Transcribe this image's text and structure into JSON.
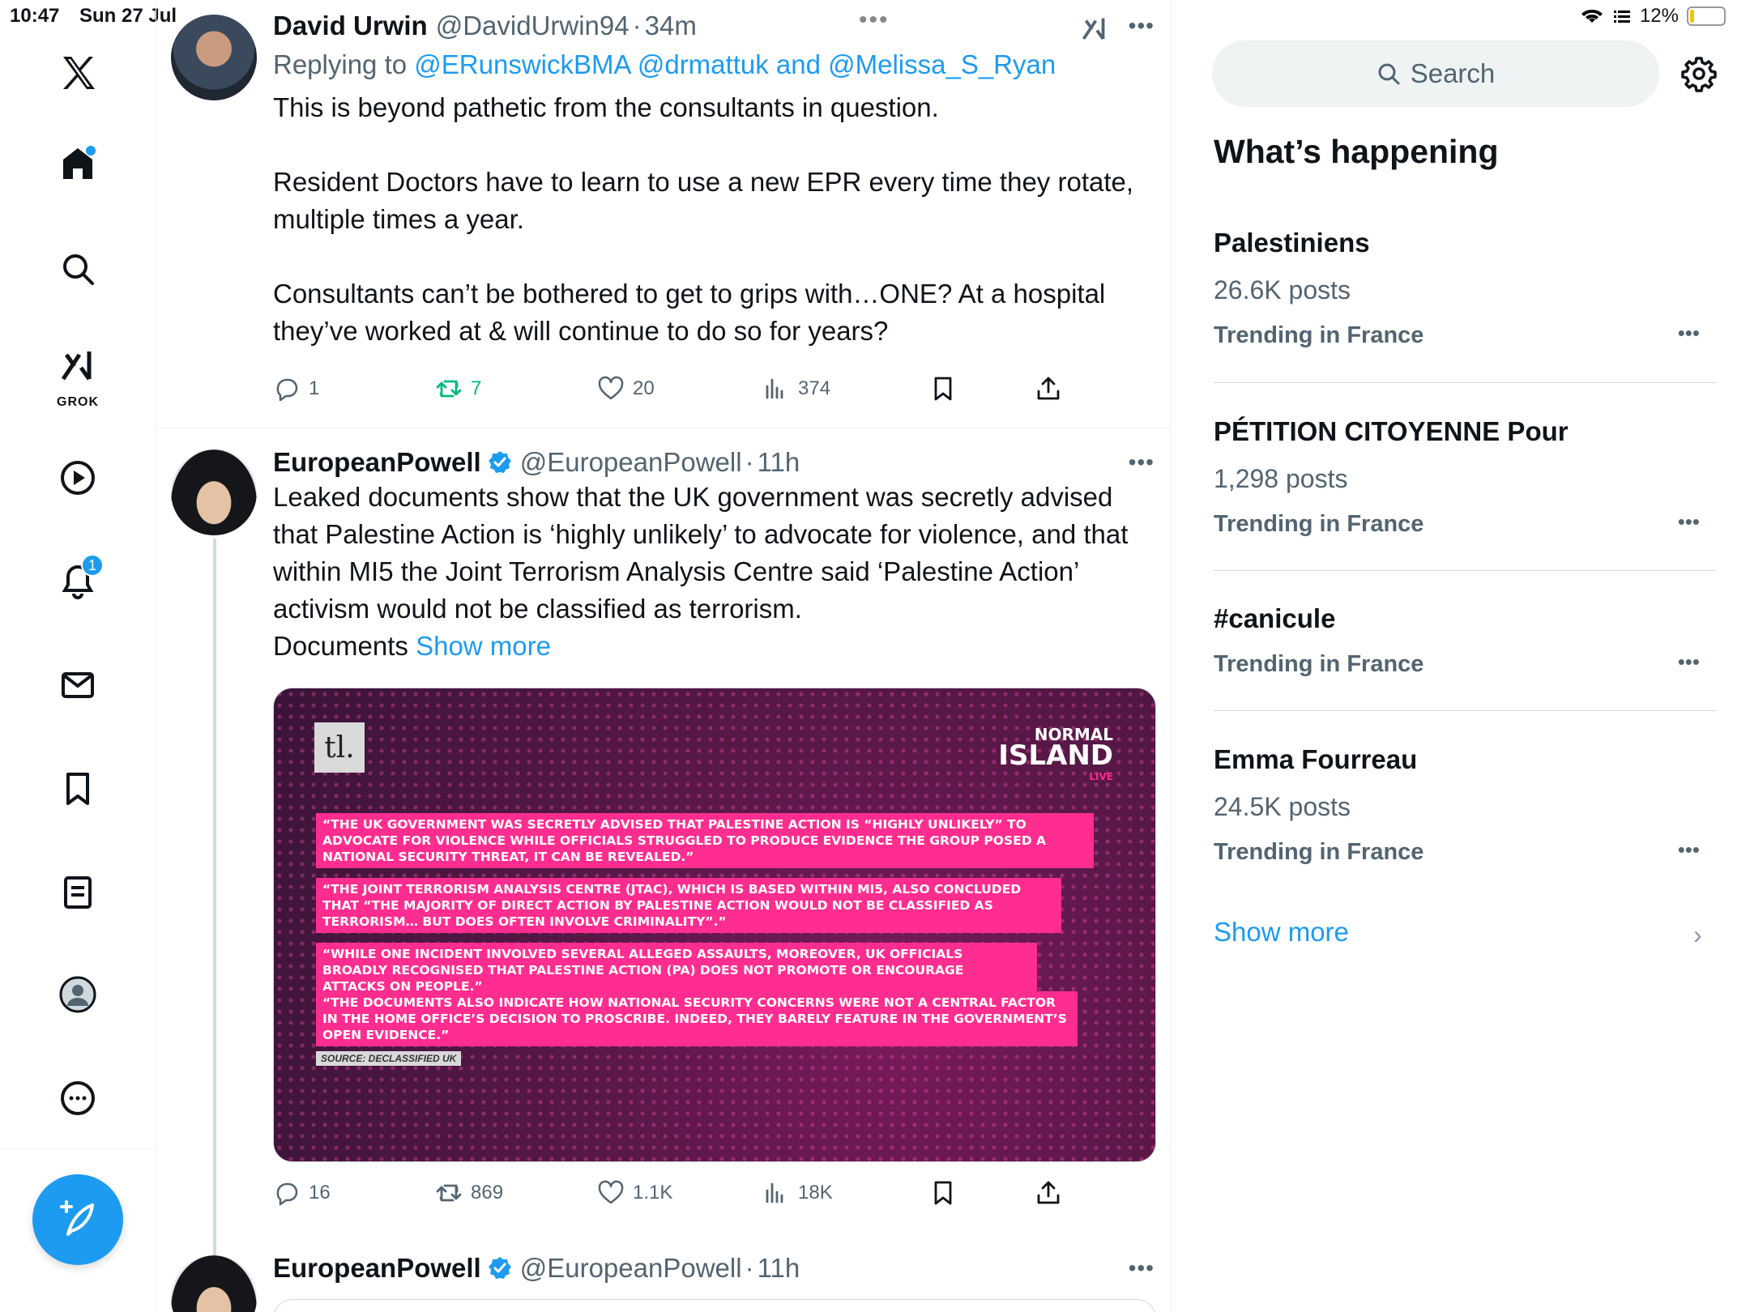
{
  "status_bar": {
    "time": "10:47",
    "date": "Sun 27 Jul",
    "battery": "12%",
    "battery_level": 0.12
  },
  "nav": {
    "logo": "x-logo-icon",
    "items": [
      "home-icon",
      "search-icon",
      "grok-icon",
      "video-icon",
      "notifications-icon",
      "messages-icon",
      "bookmarks-icon",
      "lists-icon",
      "profile-icon",
      "more-icon"
    ],
    "grok_label": "GROK",
    "notifications_badge": "1",
    "compose": "compose-icon"
  },
  "tweets": [
    {
      "name": "David Urwin",
      "handle": "@DavidUrwin94",
      "time": "34m",
      "replying_prefix": "Replying to ",
      "replying_handles": "@ERunswickBMA @drmattuk and @Melissa_S_Ryan",
      "text": "This is beyond pathetic from the consultants in question.\n\nResident Doctors have to learn to use a new EPR every time they rotate, multiple times a year.\n\nConsultants can’t be bothered to get to grips with…ONE? At a hospital they’ve worked at & will continue to do so for years?",
      "replies": "1",
      "retweets": "7",
      "likes": "20",
      "views": "374"
    },
    {
      "name": "EuropeanPowell",
      "handle": "@EuropeanPowell",
      "time": "11h",
      "text": "Leaked documents show that the UK government was secretly advised that Palestine Action is ‘highly unlikely’ to advocate for violence, and that within MI5 the Joint Terrorism Analysis Centre said ‘Palestine Action’ activism would not be classified as terrorism.\nDocuments ",
      "show_more": "Show more",
      "media": {
        "tl_logo": "tl.",
        "brand_line1": "NORMAL",
        "brand_line2": "ISLAND",
        "brand_line3": "LIVE",
        "quotes": [
          "“The UK government was secretly advised that Palestine Action is “highly unlikely” to advocate for violence while officials struggled to produce evidence the group posed a national security threat, it can be revealed.”",
          "“The Joint Terrorism Analysis Centre (JTAC), which is based within MI5, also concluded that “the majority of direct action by Palestine Action would not be classified as terrorism… but does often involve criminality”.”",
          "“While one incident involved several alleged assaults, moreover, UK officials broadly recognised that Palestine Action (PA) does not promote or encourage attacks on people.”",
          "“The documents also indicate how national security concerns were not a central factor in the Home Office’s decision to proscribe. Indeed, they barely feature in the government’s open evidence.”"
        ],
        "source": "SOURCE: DECLASSIFIED UK"
      },
      "replies": "16",
      "retweets": "869",
      "likes": "1.1K",
      "views": "18K"
    },
    {
      "name": "EuropeanPowell",
      "handle": "@EuropeanPowell",
      "time": "11h"
    }
  ],
  "sidebar": {
    "search_placeholder": "Search",
    "section_title": "What’s happening",
    "trends": [
      {
        "title": "Palestiniens",
        "count": "26.6K posts",
        "location": "Trending in France"
      },
      {
        "title": "PÉTITION CITOYENNE Pour",
        "count": "1,298 posts",
        "location": "Trending in France"
      },
      {
        "title": "#canicule",
        "count": "",
        "location": "Trending in France"
      },
      {
        "title": "Emma Fourreau",
        "count": "24.5K posts",
        "location": "Trending in France"
      }
    ],
    "show_more": "Show more"
  },
  "colors": {
    "accent": "#1d9bf0",
    "retweet_active": "#00ba7c",
    "secondary_text": "#536471",
    "quote_highlight": "#ff2d8f"
  }
}
